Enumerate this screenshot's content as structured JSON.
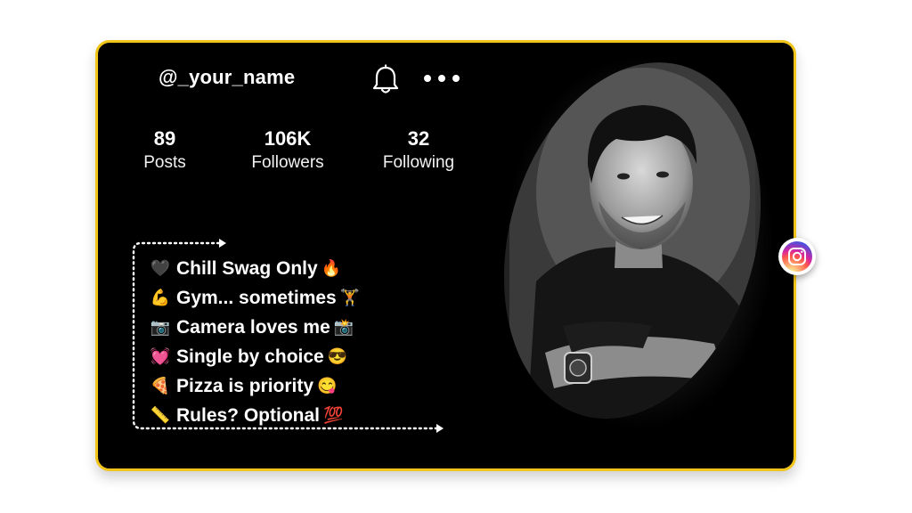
{
  "profile": {
    "username": "@_your_name",
    "icons": {
      "notifications": "bell-icon",
      "more": "more-dots-icon",
      "social": "instagram-icon"
    }
  },
  "stats": [
    {
      "value": "89",
      "label": "Posts"
    },
    {
      "value": "106K",
      "label": "Followers"
    },
    {
      "value": "32",
      "label": "Following"
    }
  ],
  "bio": [
    {
      "emoji": "🖤",
      "text": "Chill Swag Only",
      "emoji_after": "🔥"
    },
    {
      "emoji": "💪",
      "text": "Gym... sometimes",
      "emoji_after": "🏋"
    },
    {
      "emoji": "📷",
      "text": "Camera loves me",
      "emoji_after": "📸"
    },
    {
      "emoji": "💓",
      "text": "Single by choice",
      "emoji_after": "😎"
    },
    {
      "emoji": "🍕",
      "text": "Pizza is priority",
      "emoji_after": "😋"
    },
    {
      "emoji": "📏",
      "text": "Rules? Optional",
      "emoji_after": "💯"
    }
  ],
  "colors": {
    "card_background": "#000000",
    "card_border": "#f0c419",
    "page_background": "#ffffff",
    "text": "#ffffff"
  }
}
